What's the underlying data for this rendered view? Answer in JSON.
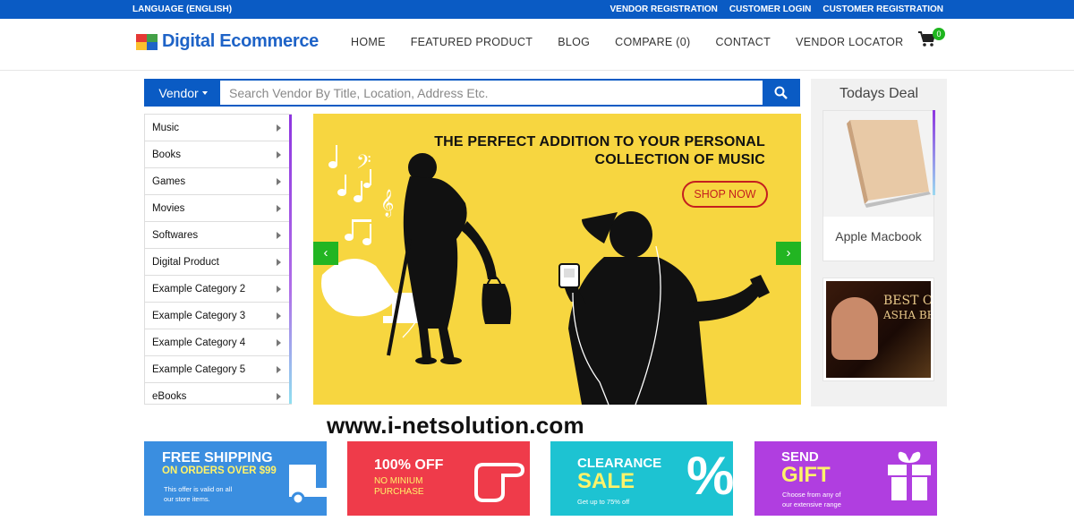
{
  "topbar": {
    "language": "LANGUAGE (ENGLISH)",
    "links": [
      "VENDOR REGISTRATION",
      "CUSTOMER LOGIN",
      "CUSTOMER REGISTRATION"
    ]
  },
  "header": {
    "logo_text": "Digital Ecommerce",
    "nav": [
      "HOME",
      "FEATURED PRODUCT",
      "BLOG",
      "COMPARE (0)",
      "CONTACT",
      "VENDOR LOCATOR"
    ],
    "cart_count": "0"
  },
  "search": {
    "dropdown_label": "Vendor",
    "placeholder": "Search Vendor By Title, Location, Address Etc."
  },
  "categories": [
    "Music",
    "Books",
    "Games",
    "Movies",
    "Softwares",
    "Digital Product",
    "Example Category 2",
    "Example Category 3",
    "Example Category 4",
    "Example Category 5",
    "eBooks"
  ],
  "banner": {
    "headline_line1": "THE PERFECT ADDITION TO YOUR PERSONAL",
    "headline_line2": "COLLECTION OF MUSIC",
    "cta": "SHOP NOW",
    "prev": "‹",
    "next": "›"
  },
  "deal": {
    "title": "Todays Deal",
    "item1_name": "Apple Macbook",
    "item2_art_line1": "BEST OF",
    "item2_art_line2": "ASHA BHOS"
  },
  "watermark": "www.i-netsolution.com",
  "promos": [
    {
      "line1": "FREE SHIPPING",
      "line2": "ON ORDERS OVER $99",
      "small1": "This offer is valid on all",
      "small2": "our store items.",
      "color": "#3a8ee0"
    },
    {
      "line1": "100% OFF",
      "line2": "NO MINIUM",
      "line3": "PURCHASE",
      "color": "#ef3b4a"
    },
    {
      "line1": "CLEARANCE",
      "line2": "SALE",
      "small1": "Get up to 75% off",
      "color": "#1dc3d2"
    },
    {
      "line1": "SEND",
      "line2": "GIFT",
      "small1": "Choose from any of",
      "small2": "our extensive range",
      "color": "#b03ee0"
    }
  ],
  "colors": {
    "brand_blue": "#0a5bc4",
    "accent_green": "#22b522",
    "banner_yellow": "#f7d640"
  }
}
